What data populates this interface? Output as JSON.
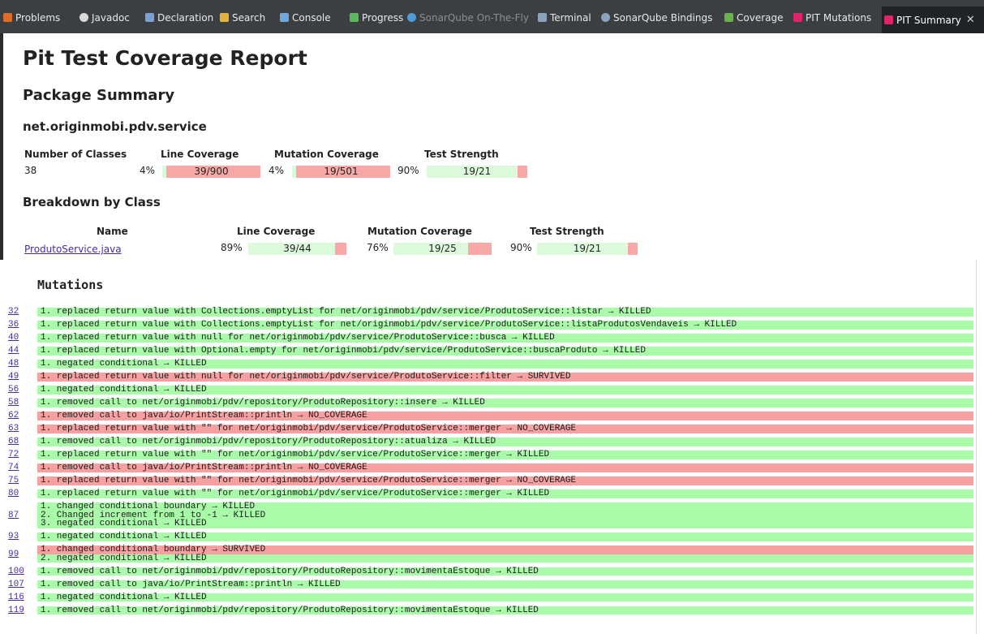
{
  "tabs": [
    {
      "label": "Problems",
      "icon": "problems-icon",
      "color": "#e06c2a"
    },
    {
      "label": "Javadoc",
      "icon": "javadoc-icon",
      "color": "#d9d9d9"
    },
    {
      "label": "Declaration",
      "icon": "declaration-icon",
      "color": "#7d9fd3"
    },
    {
      "label": "Search",
      "icon": "search-icon",
      "color": "#e3b23c"
    },
    {
      "label": "Console",
      "icon": "console-icon",
      "color": "#6fa8dc"
    },
    {
      "label": "Progress",
      "icon": "progress-icon",
      "color": "#5cb85c"
    },
    {
      "label": "SonarQube On-The-Fly",
      "icon": "sonarqube-icon",
      "color": "#4e9bd8"
    },
    {
      "label": "Terminal",
      "icon": "terminal-icon",
      "color": "#8aa3c1"
    },
    {
      "label": "SonarQube Bindings",
      "icon": "sonarqube-bindings-icon",
      "color": "#8aa3c1"
    },
    {
      "label": "Coverage",
      "icon": "coverage-icon",
      "color": "#6ab04c"
    },
    {
      "label": "PIT Mutations",
      "icon": "pit-icon",
      "color": "#e0246c"
    },
    {
      "label": "PIT Summary",
      "icon": "pit-icon",
      "color": "#e0246c"
    }
  ],
  "report": {
    "title": "Pit Test Coverage Report",
    "package_summary": "Package Summary",
    "package_name": "net.originmobi.pdv.service",
    "summary_headers": {
      "classes": "Number of Classes",
      "line": "Line Coverage",
      "mutation": "Mutation Coverage",
      "strength": "Test Strength"
    },
    "summary": {
      "classes": "38",
      "line_pct": "4%",
      "line_ratio": "39/900",
      "line_frac": 0.043,
      "mut_pct": "4%",
      "mut_ratio": "19/501",
      "mut_frac": 0.038,
      "str_pct": "90%",
      "str_ratio": "19/21",
      "str_frac": 0.9
    },
    "breakdown_title": "Breakdown by Class",
    "breakdown_headers": {
      "name": "Name",
      "line": "Line Coverage",
      "mutation": "Mutation Coverage",
      "strength": "Test Strength"
    },
    "breakdown": {
      "name": "ProdutoService.java",
      "line_pct": "89%",
      "line_ratio": "39/44",
      "line_frac": 0.886,
      "mut_pct": "76%",
      "mut_ratio": "19/25",
      "mut_frac": 0.76,
      "str_pct": "90%",
      "str_ratio": "19/21",
      "str_frac": 0.9
    }
  },
  "mutations_title": "Mutations",
  "mutations": [
    {
      "line": "32",
      "status": "KILLED",
      "items": [
        "1. replaced return value with Collections.emptyList for net/originmobi/pdv/service/ProdutoService::listar → KILLED"
      ]
    },
    {
      "line": "36",
      "status": "KILLED",
      "items": [
        "1. replaced return value with Collections.emptyList for net/originmobi/pdv/service/ProdutoService::listaProdutosVendaveis → KILLED"
      ]
    },
    {
      "line": "40",
      "status": "KILLED",
      "items": [
        "1. replaced return value with null for net/originmobi/pdv/service/ProdutoService::busca → KILLED"
      ]
    },
    {
      "line": "44",
      "status": "KILLED",
      "items": [
        "1. replaced return value with Optional.empty for net/originmobi/pdv/service/ProdutoService::buscaProduto → KILLED"
      ]
    },
    {
      "line": "48",
      "status": "KILLED",
      "items": [
        "1. negated conditional → KILLED"
      ]
    },
    {
      "line": "49",
      "status": "SURVIVED",
      "items": [
        "1. replaced return value with null for net/originmobi/pdv/service/ProdutoService::filter → SURVIVED"
      ]
    },
    {
      "line": "56",
      "status": "KILLED",
      "items": [
        "1. negated conditional → KILLED"
      ]
    },
    {
      "line": "58",
      "status": "KILLED",
      "items": [
        "1. removed call to net/originmobi/pdv/repository/ProdutoRepository::insere → KILLED"
      ]
    },
    {
      "line": "62",
      "status": "NO_COVERAGE",
      "items": [
        "1. removed call to java/io/PrintStream::println → NO_COVERAGE"
      ]
    },
    {
      "line": "63",
      "status": "NO_COVERAGE",
      "items": [
        "1. replaced return value with \"\" for net/originmobi/pdv/service/ProdutoService::merger → NO_COVERAGE"
      ]
    },
    {
      "line": "68",
      "status": "KILLED",
      "items": [
        "1. removed call to net/originmobi/pdv/repository/ProdutoRepository::atualiza → KILLED"
      ]
    },
    {
      "line": "72",
      "status": "KILLED",
      "items": [
        "1. replaced return value with \"\" for net/originmobi/pdv/service/ProdutoService::merger → KILLED"
      ]
    },
    {
      "line": "74",
      "status": "NO_COVERAGE",
      "items": [
        "1. removed call to java/io/PrintStream::println → NO_COVERAGE"
      ]
    },
    {
      "line": "75",
      "status": "NO_COVERAGE",
      "items": [
        "1. replaced return value with \"\" for net/originmobi/pdv/service/ProdutoService::merger → NO_COVERAGE"
      ]
    },
    {
      "line": "80",
      "status": "KILLED",
      "items": [
        "1. replaced return value with \"\" for net/originmobi/pdv/service/ProdutoService::merger → KILLED"
      ]
    },
    {
      "line": "87",
      "status": "KILLED",
      "items": [
        "1. changed conditional boundary → KILLED",
        "2. Changed increment from 1 to -1 → KILLED",
        "3. negated conditional → KILLED"
      ]
    },
    {
      "line": "93",
      "status": "KILLED",
      "items": [
        "1. negated conditional → KILLED"
      ]
    },
    {
      "line": "99",
      "status": "SURVIVED",
      "items": [
        "1. changed conditional boundary → SURVIVED",
        "2. negated conditional → KILLED"
      ]
    },
    {
      "line": "100",
      "status": "KILLED",
      "items": [
        "1. removed call to net/originmobi/pdv/repository/ProdutoRepository::movimentaEstoque → KILLED"
      ]
    },
    {
      "line": "107",
      "status": "KILLED",
      "items": [
        "1. removed call to java/io/PrintStream::println → KILLED"
      ]
    },
    {
      "line": "116",
      "status": "KILLED",
      "items": [
        "1. negated conditional → KILLED"
      ]
    },
    {
      "line": "119",
      "status": "KILLED",
      "items": [
        "1. removed call to net/originmobi/pdv/repository/ProdutoRepository::movimentaEstoque → KILLED"
      ]
    }
  ]
}
